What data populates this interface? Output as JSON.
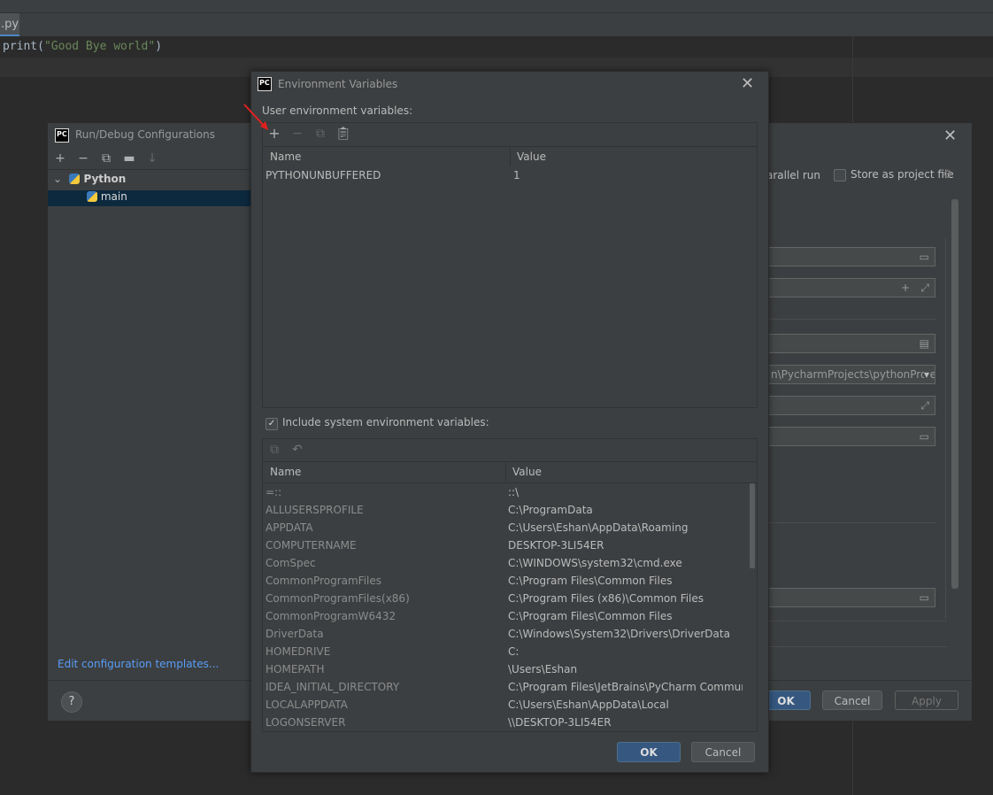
{
  "editor": {
    "tab_label": ".py",
    "code": {
      "func": "print",
      "open": "(",
      "string": "\"Good Bye world\"",
      "close": ")"
    }
  },
  "run_debug": {
    "title": "Run/Debug Configurations",
    "tree": {
      "group": "Python",
      "item": "main"
    },
    "edit_templates_link": "Edit configuration templates...",
    "help_label": "?",
    "parallel_run_label": "arallel run",
    "store_label": "Store as project file",
    "path_fragment": "n\\PycharmProjects\\pythonProjec",
    "buttons": {
      "ok": "OK",
      "cancel": "Cancel",
      "apply": "Apply"
    }
  },
  "env_dialog": {
    "title": "Environment Variables",
    "user_label": "User environment variables:",
    "columns": {
      "name": "Name",
      "value": "Value"
    },
    "user_vars": [
      {
        "name": "PYTHONUNBUFFERED",
        "value": "1"
      }
    ],
    "include_system_label": "Include system environment variables:",
    "include_system_checked": true,
    "system_vars": [
      {
        "name": "=::",
        "value": "::\\"
      },
      {
        "name": "ALLUSERSPROFILE",
        "value": "C:\\ProgramData"
      },
      {
        "name": "APPDATA",
        "value": "C:\\Users\\Eshan\\AppData\\Roaming"
      },
      {
        "name": "COMPUTERNAME",
        "value": "DESKTOP-3LI54ER"
      },
      {
        "name": "ComSpec",
        "value": "C:\\WINDOWS\\system32\\cmd.exe"
      },
      {
        "name": "CommonProgramFiles",
        "value": "C:\\Program Files\\Common Files"
      },
      {
        "name": "CommonProgramFiles(x86)",
        "value": "C:\\Program Files (x86)\\Common Files"
      },
      {
        "name": "CommonProgramW6432",
        "value": "C:\\Program Files\\Common Files"
      },
      {
        "name": "DriverData",
        "value": "C:\\Windows\\System32\\Drivers\\DriverData"
      },
      {
        "name": "HOMEDRIVE",
        "value": "C:"
      },
      {
        "name": "HOMEPATH",
        "value": "\\Users\\Eshan"
      },
      {
        "name": "IDEA_INITIAL_DIRECTORY",
        "value": "C:\\Program Files\\JetBrains\\PyCharm Communit..."
      },
      {
        "name": "LOCALAPPDATA",
        "value": "C:\\Users\\Eshan\\AppData\\Local"
      },
      {
        "name": "LOGONSERVER",
        "value": "\\\\DESKTOP-3LI54ER"
      }
    ],
    "buttons": {
      "ok": "OK",
      "cancel": "Cancel"
    }
  },
  "colors": {
    "accent": "#365880",
    "link": "#589df6",
    "annotation_arrow": "#e02020"
  },
  "icons": [
    "add-icon",
    "remove-icon",
    "copy-icon",
    "paste-icon",
    "close-icon",
    "folder-icon",
    "expand-icon",
    "undo-icon",
    "gear-icon",
    "python-icon"
  ]
}
